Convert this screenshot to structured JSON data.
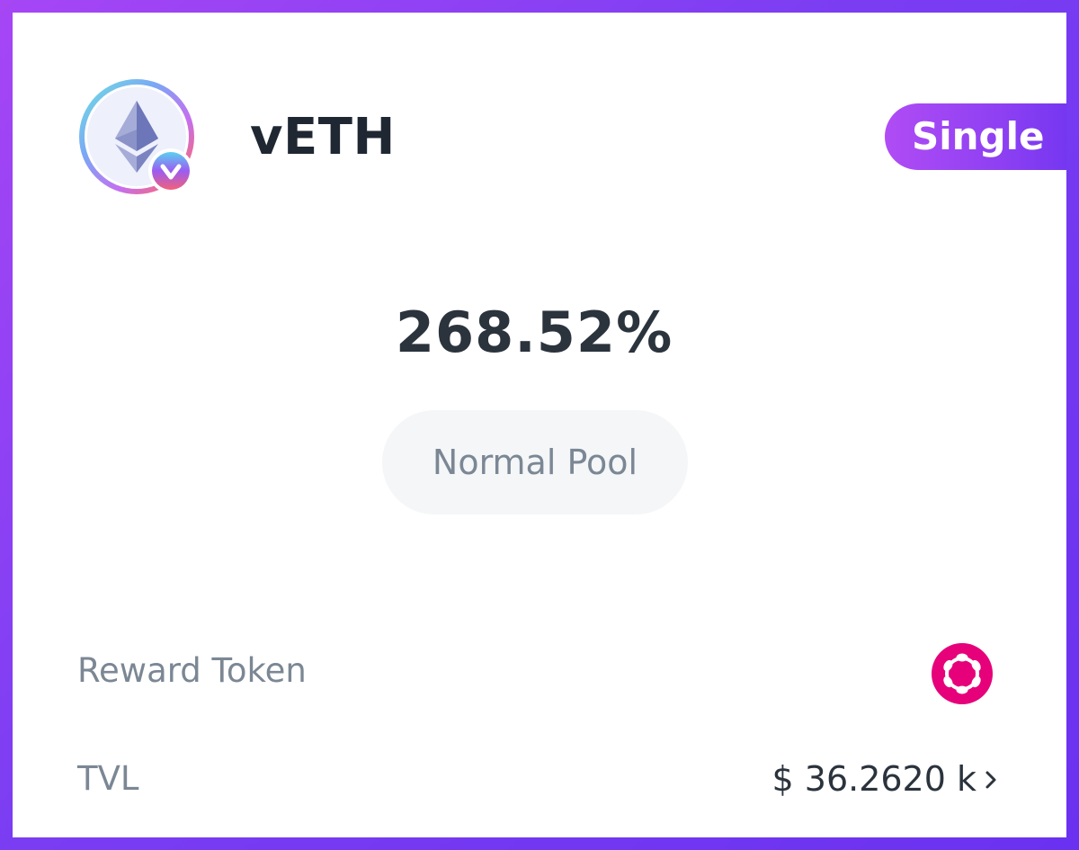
{
  "pool": {
    "token_name": "vETH",
    "type_badge": "Single",
    "apr": "268.52%",
    "pool_type": "Normal Pool"
  },
  "rows": {
    "reward_label": "Reward Token",
    "tvl_label": "TVL",
    "tvl_value": "$ 36.2620 k"
  },
  "icons": {
    "token_logo": "ethereum-icon",
    "token_badge": "v-badge-icon",
    "reward_token": "polkadot-icon",
    "tvl_link": "chevron-right-icon"
  },
  "colors": {
    "frame_gradient_start": "#a646f5",
    "frame_gradient_end": "#6a32f0",
    "badge_gradient_start": "#b04cf5",
    "badge_gradient_end": "#6c33f0",
    "reward_token_pink": "#e6007a",
    "text_dark": "#2b333d",
    "text_muted": "#7b8794",
    "pill_bg": "#f4f6f8"
  }
}
